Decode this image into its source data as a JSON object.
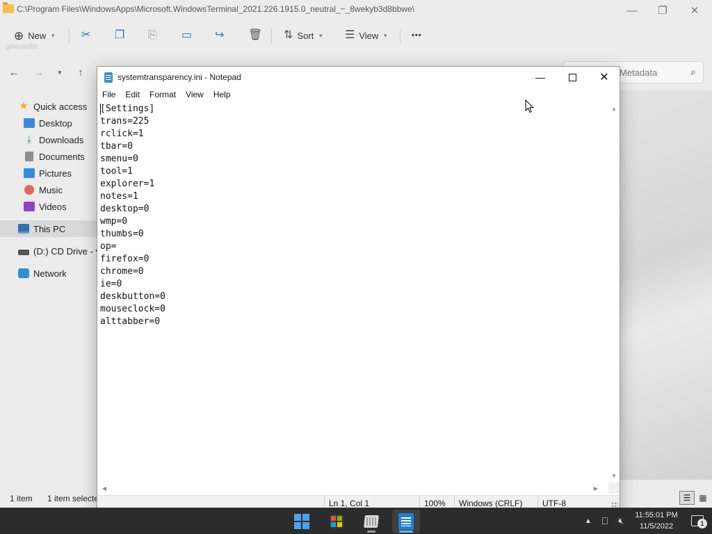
{
  "explorer": {
    "title": "C:\\Program Files\\WindowsApps\\Microsoft.WindowsTerminal_2021.226.1915.0_neutral_~_8wekyb3d8bbwe\\",
    "toolbar": {
      "new_label": "New",
      "sort_label": "Sort",
      "view_label": "View",
      "more_label": "•••",
      "ghost_text": "gdatatelbb"
    },
    "search": {
      "placeholder_visible": "Metadata"
    },
    "sidebar": {
      "items": [
        {
          "label": "Quick access",
          "icon": "star-icon"
        },
        {
          "label": "Desktop",
          "icon": "desktop-icon"
        },
        {
          "label": "Downloads",
          "icon": "download-icon"
        },
        {
          "label": "Documents",
          "icon": "documents-icon"
        },
        {
          "label": "Pictures",
          "icon": "pictures-icon"
        },
        {
          "label": "Music",
          "icon": "music-icon"
        },
        {
          "label": "Videos",
          "icon": "videos-icon"
        },
        {
          "label": "This PC",
          "icon": "computer-icon"
        },
        {
          "label": "(D:) CD Drive - vi",
          "icon": "cd-drive-icon"
        },
        {
          "label": "Network",
          "icon": "network-icon"
        }
      ]
    },
    "status": {
      "count": "1 item",
      "selection": "1 item selecte"
    }
  },
  "notepad": {
    "title": "systemtransparency.ini - Notepad",
    "menu": [
      "File",
      "Edit",
      "Format",
      "View",
      "Help"
    ],
    "lines": [
      "[Settings]",
      "trans=225",
      "rclick=1",
      "tbar=0",
      "smenu=0",
      "tool=1",
      "explorer=1",
      "notes=1",
      "desktop=0",
      "wmp=0",
      "thumbs=0",
      "op=",
      "firefox=0",
      "chrome=0",
      "ie=0",
      "deskbutton=0",
      "mouseclock=0",
      "alttabber=0"
    ],
    "status": {
      "position": "Ln 1, Col 1",
      "zoom": "100%",
      "line_ending": "Windows (CRLF)",
      "encoding": "UTF-8"
    }
  },
  "taskbar": {
    "apps": [
      {
        "name": "Start",
        "icon": "windows-start-icon"
      },
      {
        "name": "Microsoft Store",
        "icon": "store-icon"
      },
      {
        "name": "File Explorer",
        "icon": "file-explorer-icon"
      },
      {
        "name": "Notepad",
        "icon": "notepad-icon",
        "active": true
      }
    ],
    "tray": {
      "time": "11:55:01 PM",
      "date": "11/5/2022",
      "notifications": "1"
    }
  },
  "colors": {
    "accent": "#1f7fd0",
    "taskbar": "#2c2c2c",
    "explorer_bg": "#ececec"
  }
}
